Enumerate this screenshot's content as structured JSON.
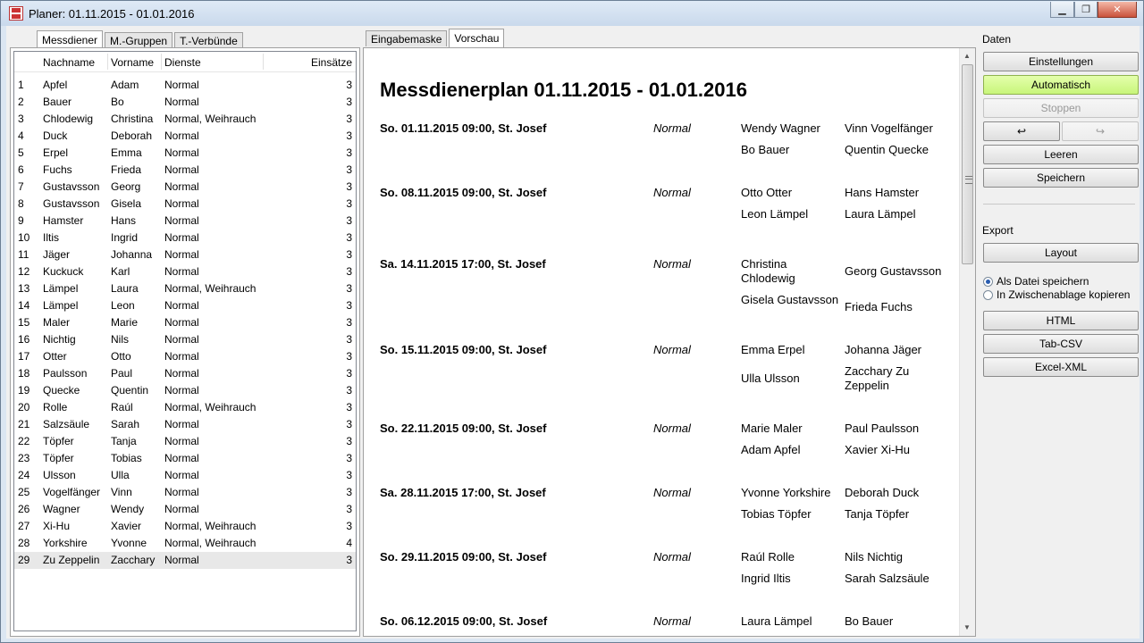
{
  "window": {
    "title": "Planer: 01.11.2015 - 01.01.2016"
  },
  "left_tabs": [
    "Messdiener",
    "M.-Gruppen",
    "T.-Verbünde"
  ],
  "table": {
    "columns": [
      "Nachname",
      "Vorname",
      "Dienste",
      "Einsätze"
    ],
    "rows": [
      [
        "1",
        "Apfel",
        "Adam",
        "Normal",
        "3"
      ],
      [
        "2",
        "Bauer",
        "Bo",
        "Normal",
        "3"
      ],
      [
        "3",
        "Chlodewig",
        "Christina",
        "Normal, Weihrauch",
        "3"
      ],
      [
        "4",
        "Duck",
        "Deborah",
        "Normal",
        "3"
      ],
      [
        "5",
        "Erpel",
        "Emma",
        "Normal",
        "3"
      ],
      [
        "6",
        "Fuchs",
        "Frieda",
        "Normal",
        "3"
      ],
      [
        "7",
        "Gustavsson",
        "Georg",
        "Normal",
        "3"
      ],
      [
        "8",
        "Gustavsson",
        "Gisela",
        "Normal",
        "3"
      ],
      [
        "9",
        "Hamster",
        "Hans",
        "Normal",
        "3"
      ],
      [
        "10",
        "Iltis",
        "Ingrid",
        "Normal",
        "3"
      ],
      [
        "11",
        "Jäger",
        "Johanna",
        "Normal",
        "3"
      ],
      [
        "12",
        "Kuckuck",
        "Karl",
        "Normal",
        "3"
      ],
      [
        "13",
        "Lämpel",
        "Laura",
        "Normal, Weihrauch",
        "3"
      ],
      [
        "14",
        "Lämpel",
        "Leon",
        "Normal",
        "3"
      ],
      [
        "15",
        "Maler",
        "Marie",
        "Normal",
        "3"
      ],
      [
        "16",
        "Nichtig",
        "Nils",
        "Normal",
        "3"
      ],
      [
        "17",
        "Otter",
        "Otto",
        "Normal",
        "3"
      ],
      [
        "18",
        "Paulsson",
        "Paul",
        "Normal",
        "3"
      ],
      [
        "19",
        "Quecke",
        "Quentin",
        "Normal",
        "3"
      ],
      [
        "20",
        "Rolle",
        "Raúl",
        "Normal, Weihrauch",
        "3"
      ],
      [
        "21",
        "Salzsäule",
        "Sarah",
        "Normal",
        "3"
      ],
      [
        "22",
        "Töpfer",
        "Tanja",
        "Normal",
        "3"
      ],
      [
        "23",
        "Töpfer",
        "Tobias",
        "Normal",
        "3"
      ],
      [
        "24",
        "Ulsson",
        "Ulla",
        "Normal",
        "3"
      ],
      [
        "25",
        "Vogelfänger",
        "Vinn",
        "Normal",
        "3"
      ],
      [
        "26",
        "Wagner",
        "Wendy",
        "Normal",
        "3"
      ],
      [
        "27",
        "Xi-Hu",
        "Xavier",
        "Normal, Weihrauch",
        "3"
      ],
      [
        "28",
        "Yorkshire",
        "Yvonne",
        "Normal, Weihrauch",
        "4"
      ],
      [
        "29",
        "Zu Zeppelin",
        "Zacchary",
        "Normal",
        "3"
      ]
    ]
  },
  "center_tabs": [
    "Eingabemaske",
    "Vorschau"
  ],
  "preview": {
    "title": "Messdienerplan 01.11.2015 - 01.01.2016",
    "entries": [
      {
        "date": "So. 01.11.2015 09:00, St. Josef",
        "type": "Normal",
        "names": [
          "Wendy Wagner",
          "Vinn Vogelfänger",
          "Bo Bauer",
          "Quentin Quecke"
        ]
      },
      {
        "date": "So. 08.11.2015 09:00, St. Josef",
        "type": "Normal",
        "names": [
          "Otto Otter",
          "Hans Hamster",
          "Leon Lämpel",
          "Laura Lämpel"
        ]
      },
      {
        "date": "Sa. 14.11.2015 17:00, St. Josef",
        "type": "Normal",
        "names": [
          "Christina Chlodewig",
          "Georg Gustavsson",
          "Gisela Gustavsson",
          "Frieda Fuchs"
        ]
      },
      {
        "date": "So. 15.11.2015 09:00, St. Josef",
        "type": "Normal",
        "names": [
          "Emma Erpel",
          "Johanna Jäger",
          "Ulla Ulsson",
          "Zacchary Zu Zeppelin"
        ]
      },
      {
        "date": "So. 22.11.2015 09:00, St. Josef",
        "type": "Normal",
        "names": [
          "Marie Maler",
          "Paul Paulsson",
          "Adam Apfel",
          "Xavier Xi-Hu"
        ]
      },
      {
        "date": "Sa. 28.11.2015 17:00, St. Josef",
        "type": "Normal",
        "names": [
          "Yvonne Yorkshire",
          "Deborah Duck",
          "Tobias Töpfer",
          "Tanja Töpfer"
        ]
      },
      {
        "date": "So. 29.11.2015 09:00, St. Josef",
        "type": "Normal",
        "names": [
          "Raúl Rolle",
          "Nils Nichtig",
          "Ingrid Iltis",
          "Sarah Salzsäule"
        ]
      },
      {
        "date": "So. 06.12.2015 09:00, St. Josef",
        "type": "Normal",
        "names": [
          "Laura Lämpel",
          "Bo Bauer"
        ]
      }
    ]
  },
  "right": {
    "daten_label": "Daten",
    "einstellungen": "Einstellungen",
    "automatisch": "Automatisch",
    "stoppen": "Stoppen",
    "undo": "↩",
    "redo": "↪",
    "leeren": "Leeren",
    "speichern": "Speichern",
    "export_label": "Export",
    "layout": "Layout",
    "radio_file": "Als Datei speichern",
    "radio_clipboard": "In Zwischenablage kopieren",
    "html": "HTML",
    "tabcsv": "Tab-CSV",
    "excelxml": "Excel-XML"
  },
  "colors": {
    "automatisch_bg": "#c8f57a"
  }
}
